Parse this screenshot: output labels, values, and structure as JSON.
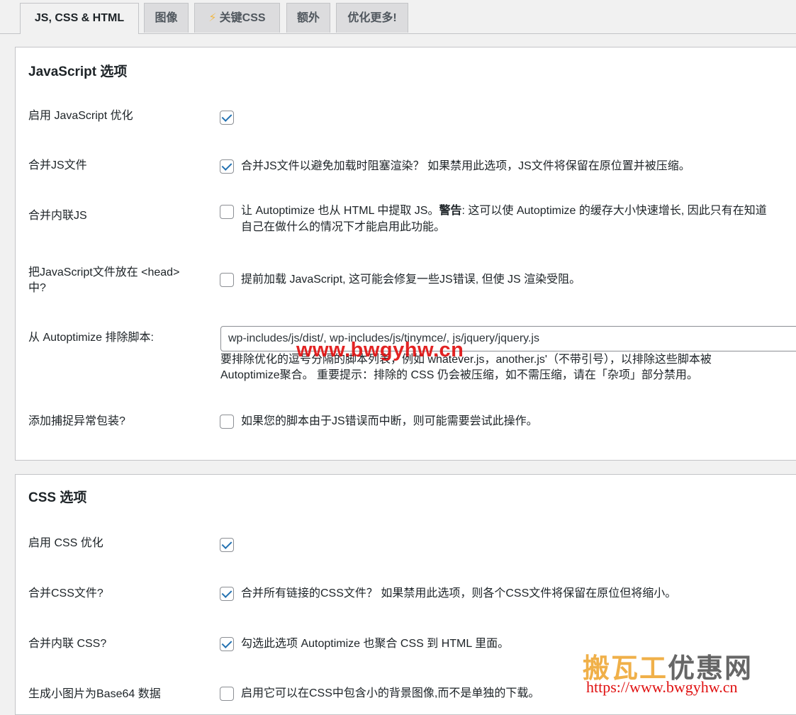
{
  "tabs": [
    {
      "label": "JS, CSS & HTML",
      "active": true
    },
    {
      "label": "图像"
    },
    {
      "label": "关键CSS",
      "icon": "lightning-icon"
    },
    {
      "label": "额外"
    },
    {
      "label": "优化更多!"
    }
  ],
  "js_section": {
    "title": "JavaScript 选项",
    "enable": {
      "label": "启用 JavaScript 优化",
      "checked": true
    },
    "aggregate": {
      "label": "合并JS文件",
      "checked": true,
      "desc": "合并JS文件以避免加载时阻塞渲染？ 如果禁用此选项，JS文件将保留在原位置并被压缩。"
    },
    "inline": {
      "label": "合并内联JS",
      "checked": false,
      "desc_1a": "让 Autoptimize 也从 HTML 中提取 JS。",
      "desc_1b": "警告",
      "desc_1c": ": 这可以使 Autoptimize 的缓存大小快速增长, 因此只有在知道",
      "desc_2": "自己在做什么的情况下才能启用此功能。"
    },
    "head": {
      "label_1": "把JavaScript文件放在 <head>",
      "label_2": "中?",
      "checked": false,
      "desc": "提前加载 JavaScript, 这可能会修复一些JS错误, 但使 JS 渲染受阻。"
    },
    "exclude": {
      "label": "从 Autoptimize 排除脚本:",
      "value": "wp-includes/js/dist/, wp-includes/js/tinymce/, js/jquery/jquery.js",
      "help_1": "要排除优化的逗号分隔的脚本列表，例如 whatever.js，another.js'（不带引号），以排除这些脚本被",
      "help_2": "Autoptimize聚合。 重要提示：排除的 CSS 仍会被压缩，如不需压缩，请在「杂项」部分禁用。"
    },
    "trycatch": {
      "label": "添加捕捉异常包装?",
      "checked": false,
      "desc": "如果您的脚本由于JS错误而中断，则可能需要尝试此操作。"
    }
  },
  "css_section": {
    "title": "CSS 选项",
    "enable": {
      "label": "启用 CSS 优化",
      "checked": true
    },
    "aggregate": {
      "label": "合并CSS文件?",
      "checked": true,
      "desc": "合并所有链接的CSS文件？ 如果禁用此选项，则各个CSS文件将保留在原位但将缩小。"
    },
    "inline": {
      "label": "合并内联 CSS?",
      "checked": true,
      "desc": "勾选此选项 Autoptimize 也聚合 CSS 到 HTML 里面。"
    },
    "base64": {
      "label": "生成小图片为Base64 数据",
      "checked": false,
      "desc": "启用它可以在CSS中包含小的背景图像,而不是单独的下载。"
    }
  },
  "watermarks": {
    "url": "www.bwgyhw.cn",
    "logo_1": "搬瓦工",
    "logo_2": "优惠网",
    "site": "https://www.bwgyhw.cn"
  }
}
